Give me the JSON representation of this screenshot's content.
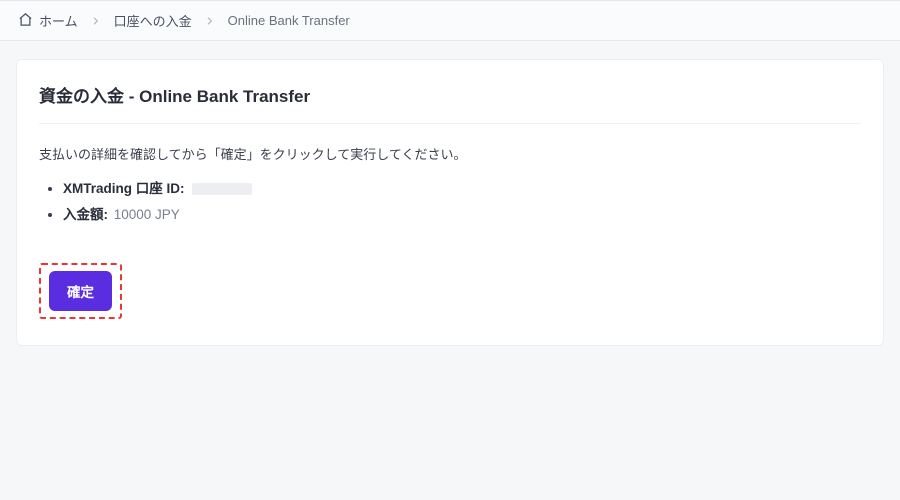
{
  "breadcrumb": {
    "home": "ホーム",
    "deposit": "口座への入金",
    "current": "Online Bank Transfer"
  },
  "card": {
    "title": "資金の入金 - Online Bank Transfer",
    "instruction": "支払いの詳細を確認してから「確定」をクリックして実行してください。",
    "account_label": "XMTrading 口座 ID:",
    "account_value": "",
    "amount_label": "入金額:",
    "amount_value": "10000 JPY",
    "confirm_label": "確定"
  },
  "colors": {
    "accent": "#5b2de0",
    "callout_border": "#e53935"
  }
}
